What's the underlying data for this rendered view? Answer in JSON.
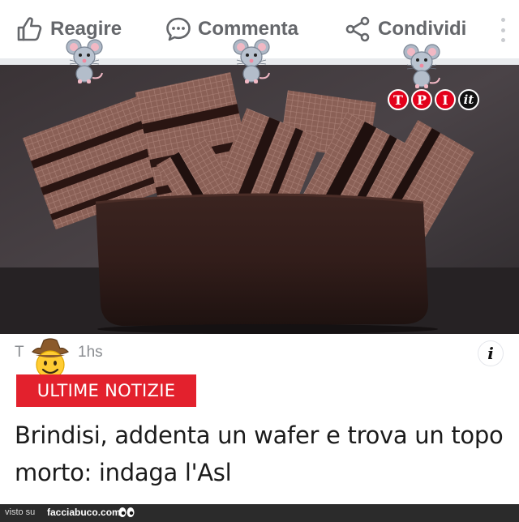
{
  "actions": {
    "react_label": "Reagire",
    "comment_label": "Commenta",
    "share_label": "Condividi"
  },
  "photo": {
    "logo_letters": [
      "T",
      "P",
      "I"
    ],
    "logo_suffix": "it"
  },
  "source": {
    "name": "T",
    "time": "1hs"
  },
  "badge_label": "ULTIME NOTIZIE",
  "headline": "Brindisi, addenta un wafer e trova un topo morto: indaga l'Asl",
  "footer": {
    "seen_on": "visto su",
    "site": "facciabuco.com"
  },
  "colors": {
    "accent_red": "#e3212d",
    "action_gray": "#65676b",
    "background": "#ffffff"
  },
  "icons": [
    "thumbs-up-icon",
    "comment-bubble-icon",
    "share-nodes-icon",
    "more-vertical-icon",
    "mouse-emoji-icon",
    "cowboy-face-emoji-icon",
    "info-icon",
    "eyes-icon"
  ]
}
